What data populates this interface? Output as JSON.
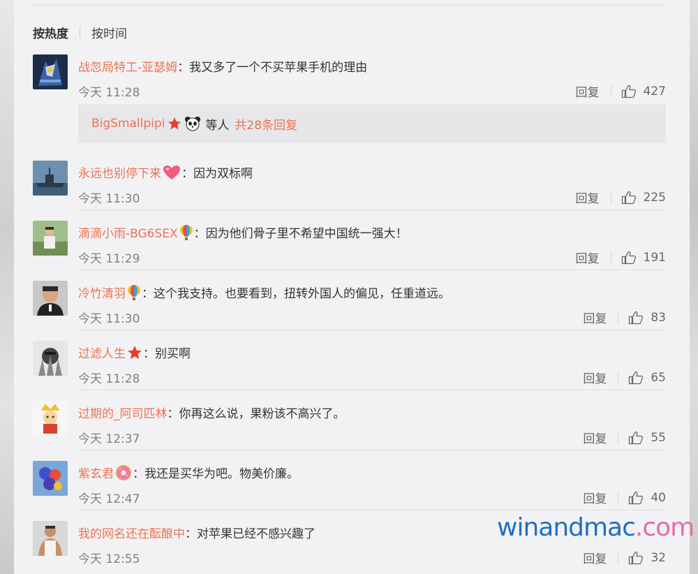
{
  "sort": {
    "active": "按热度",
    "other": "按时间"
  },
  "reply_label": "回复",
  "comments": [
    {
      "user": "战忽局特工-亚瑟姆",
      "badges": [],
      "text": "我又多了一个不买苹果手机的理由",
      "time": "今天 11:28",
      "likes": "427",
      "avatar": "robot-avatar"
    },
    {
      "user": "永远也别停下来",
      "badges": [
        "heart-icon"
      ],
      "text": "因为双标啊",
      "time": "今天 11:30",
      "likes": "225",
      "avatar": "warship-avatar"
    },
    {
      "user": "滴滴小雨-BG6SEX",
      "badges": [
        "balloon-icon"
      ],
      "text": "因为他们骨子里不希望中国统一强大！",
      "time": "今天 11:29",
      "likes": "191",
      "avatar": "outdoor-avatar"
    },
    {
      "user": "冷竹清羽",
      "badges": [
        "balloon-icon"
      ],
      "text": "这个我支持。也要看到，扭转外国人的偏见，任重道远。",
      "time": "今天 11:30",
      "likes": "83",
      "avatar": "man-portrait-avatar"
    },
    {
      "user": "过滤人生",
      "badges": [
        "star-icon"
      ],
      "text": "别买啊",
      "time": "今天 11:28",
      "likes": "65",
      "avatar": "wolverine-avatar"
    },
    {
      "user": "过期的_阿司匹林",
      "badges": [],
      "text": "你再这么说，果粉该不高兴了。",
      "time": "今天 12:37",
      "likes": "55",
      "avatar": "cartoon-king-avatar"
    },
    {
      "user": "紫玄君",
      "badges": [
        "donut-icon"
      ],
      "text": "我还是买华为吧。物美价廉。",
      "time": "今天 12:47",
      "likes": "40",
      "avatar": "flower-avatar"
    },
    {
      "user": "我的网名还在酝酿中",
      "badges": [],
      "text": "对苹果已经不感兴趣了",
      "time": "今天 12:55",
      "likes": "32",
      "avatar": "muscle-man-avatar"
    }
  ],
  "reply_preview": {
    "user": "BigSmallpipi",
    "icons": [
      "star-icon",
      "panda-icon"
    ],
    "others": "等人",
    "count": "共28条回复"
  },
  "watermark": {
    "part1": "winandmac",
    "part2": ".com"
  },
  "colors": {
    "username": "#eb7350",
    "text": "#333333",
    "time": "#808080",
    "panel": "#f2f2f5"
  }
}
